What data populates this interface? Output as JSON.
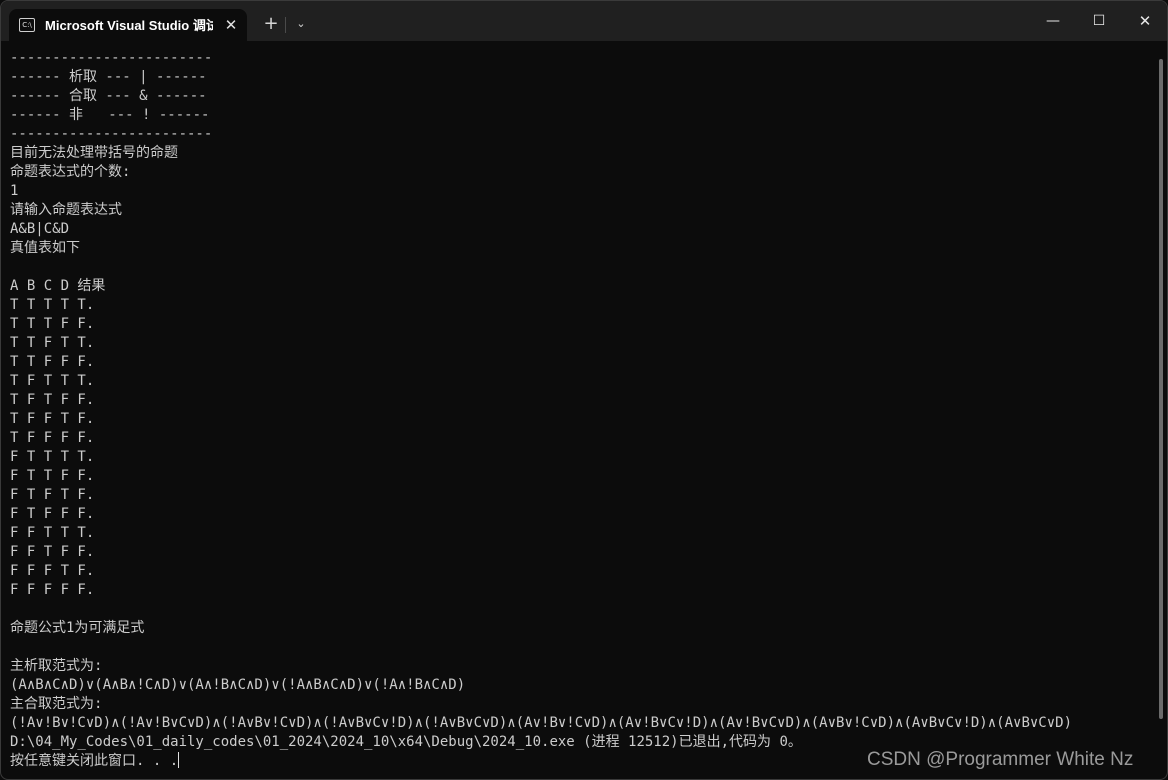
{
  "titlebar": {
    "tab_title": "Microsoft Visual Studio 调试控制台",
    "tab_icon_text": "C:\\",
    "close_tab_glyph": "✕",
    "new_tab_glyph": "+",
    "dropdown_glyph": "⌄",
    "minimize_glyph": "—",
    "maximize_glyph": "☐",
    "close_glyph": "✕"
  },
  "terminal": {
    "lines": [
      "------------------------",
      "------ 析取 --- | ------",
      "------ 合取 --- & ------",
      "------ 非   --- ! ------",
      "------------------------",
      "目前无法处理带括号的命题",
      "命题表达式的个数:",
      "1",
      "请输入命题表达式",
      "A&B|C&D",
      "真值表如下",
      "",
      "A B C D 结果",
      "T T T T T.",
      "T T T F F.",
      "T T F T T.",
      "T T F F F.",
      "T F T T T.",
      "T F T F F.",
      "T F F T F.",
      "T F F F F.",
      "F T T T T.",
      "F T T F F.",
      "F T F T F.",
      "F T F F F.",
      "F F T T T.",
      "F F T F F.",
      "F F F T F.",
      "F F F F F.",
      "",
      "命题公式1为可满足式",
      "",
      "主析取范式为:",
      "(A∧B∧C∧D)∨(A∧B∧!C∧D)∨(A∧!B∧C∧D)∨(!A∧B∧C∧D)∨(!A∧!B∧C∧D)",
      "主合取范式为:",
      "(!A∨!B∨!C∨D)∧(!A∨!B∨C∨D)∧(!A∨B∨!C∨D)∧(!A∨B∨C∨!D)∧(!A∨B∨C∨D)∧(A∨!B∨!C∨D)∧(A∨!B∨C∨!D)∧(A∨!B∨C∨D)∧(A∨B∨!C∨D)∧(A∨B∨C∨!D)∧(A∨B∨C∨D)",
      "D:\\04_My_Codes\\01_daily_codes\\01_2024\\2024_10\\x64\\Debug\\2024_10.exe (进程 12512)已退出,代码为 0。",
      "按任意键关闭此窗口. . ."
    ]
  },
  "watermark": "CSDN @Programmer White Nz"
}
